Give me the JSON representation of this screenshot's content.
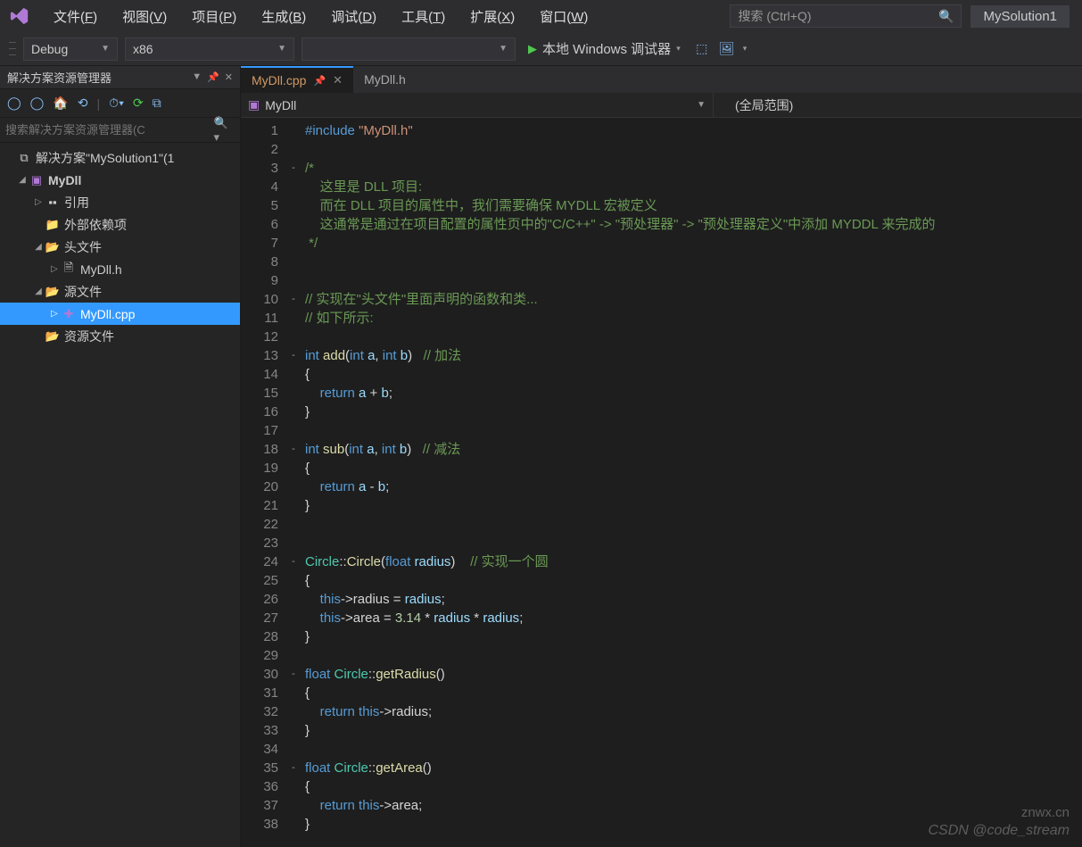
{
  "menubar": {
    "items": [
      "文件(F)",
      "视图(V)",
      "项目(P)",
      "生成(B)",
      "调试(D)",
      "工具(T)",
      "扩展(X)",
      "窗口(W)"
    ],
    "search_placeholder": "搜索 (Ctrl+Q)",
    "solution_label": "MySolution1"
  },
  "toolbar": {
    "config": "Debug",
    "platform": "x86",
    "target": "",
    "run_label": "本地 Windows 调试器"
  },
  "sidebar": {
    "title": "解决方案资源管理器",
    "search_placeholder": "搜索解决方案资源管理器(C",
    "solution": "解决方案\"MySolution1\"(1",
    "project": "MyDll",
    "refs": "引用",
    "external": "外部依赖项",
    "headers": "头文件",
    "header_file": "MyDll.h",
    "sources": "源文件",
    "source_file": "MyDll.cpp",
    "resources": "资源文件"
  },
  "tabs": {
    "active": "MyDll.cpp",
    "inactive": "MyDll.h"
  },
  "navbar": {
    "left": "MyDll",
    "right": "(全局范围)"
  },
  "code": {
    "lines": [
      {
        "n": 1,
        "f": "",
        "html": "<span class='kw'>#include</span> <span class='st'>\"MyDll.h\"</span>"
      },
      {
        "n": 2,
        "f": "",
        "html": ""
      },
      {
        "n": 3,
        "f": "-",
        "html": "<span class='cm'>/*</span>"
      },
      {
        "n": 4,
        "f": "",
        "html": "    <span class='cm'>这里是 DLL 项目:</span>"
      },
      {
        "n": 5,
        "f": "",
        "html": "    <span class='cm'>而在 DLL 项目的属性中，我们需要确保 MYDLL 宏被定义</span>"
      },
      {
        "n": 6,
        "f": "",
        "html": "    <span class='cm'>这通常是通过在项目配置的属性页中的\"C/C++\" -> \"预处理器\" -> \"预处理器定义\"中添加 MYDDL 来完成的</span>"
      },
      {
        "n": 7,
        "f": "",
        "html": " <span class='cm'>*/</span>"
      },
      {
        "n": 8,
        "f": "",
        "html": ""
      },
      {
        "n": 9,
        "f": "",
        "html": ""
      },
      {
        "n": 10,
        "f": "-",
        "html": "<span class='cm'>// 实现在\"头文件\"里面声明的函数和类...</span>"
      },
      {
        "n": 11,
        "f": "",
        "html": "<span class='cm'>// 如下所示:</span>"
      },
      {
        "n": 12,
        "f": "",
        "html": ""
      },
      {
        "n": 13,
        "f": "-",
        "html": "<span class='kw'>int</span> <span class='fn'>add</span>(<span class='kw'>int</span> <span class='id'>a</span>, <span class='kw'>int</span> <span class='id'>b</span>)   <span class='cm'>// 加法</span>"
      },
      {
        "n": 14,
        "f": "",
        "html": "{"
      },
      {
        "n": 15,
        "f": "",
        "html": "    <span class='kw'>return</span> <span class='id'>a</span> + <span class='id'>b</span>;"
      },
      {
        "n": 16,
        "f": "",
        "html": "}"
      },
      {
        "n": 17,
        "f": "",
        "html": ""
      },
      {
        "n": 18,
        "f": "-",
        "html": "<span class='kw'>int</span> <span class='fn'>sub</span>(<span class='kw'>int</span> <span class='id'>a</span>, <span class='kw'>int</span> <span class='id'>b</span>)   <span class='cm'>// 减法</span>"
      },
      {
        "n": 19,
        "f": "",
        "html": "{"
      },
      {
        "n": 20,
        "f": "",
        "html": "    <span class='kw'>return</span> <span class='id'>a</span> - <span class='id'>b</span>;"
      },
      {
        "n": 21,
        "f": "",
        "html": "}"
      },
      {
        "n": 22,
        "f": "",
        "html": ""
      },
      {
        "n": 23,
        "f": "",
        "html": ""
      },
      {
        "n": 24,
        "f": "-",
        "html": "<span class='ty'>Circle</span>::<span class='fn'>Circle</span>(<span class='kw'>float</span> <span class='id'>radius</span>)    <span class='cm'>// 实现一个圆</span>"
      },
      {
        "n": 25,
        "f": "",
        "html": "{"
      },
      {
        "n": 26,
        "f": "",
        "html": "    <span class='kw'>this</span>-&gt;radius = <span class='id'>radius</span>;"
      },
      {
        "n": 27,
        "f": "",
        "html": "    <span class='kw'>this</span>-&gt;area = <span class='nu'>3.14</span> * <span class='id'>radius</span> * <span class='id'>radius</span>;"
      },
      {
        "n": 28,
        "f": "",
        "html": "}"
      },
      {
        "n": 29,
        "f": "",
        "html": ""
      },
      {
        "n": 30,
        "f": "-",
        "html": "<span class='kw'>float</span> <span class='ty'>Circle</span>::<span class='fn'>getRadius</span>()"
      },
      {
        "n": 31,
        "f": "",
        "html": "{"
      },
      {
        "n": 32,
        "f": "",
        "html": "    <span class='kw'>return</span> <span class='kw'>this</span>-&gt;radius;"
      },
      {
        "n": 33,
        "f": "",
        "html": "}"
      },
      {
        "n": 34,
        "f": "",
        "html": ""
      },
      {
        "n": 35,
        "f": "-",
        "html": "<span class='kw'>float</span> <span class='ty'>Circle</span>::<span class='fn'>getArea</span>()"
      },
      {
        "n": 36,
        "f": "",
        "html": "{"
      },
      {
        "n": 37,
        "f": "",
        "html": "    <span class='kw'>return</span> <span class='kw'>this</span>-&gt;area;"
      },
      {
        "n": 38,
        "f": "",
        "html": "}"
      }
    ]
  },
  "watermark": {
    "l1": "znwx.cn",
    "l2": "CSDN @code_stream"
  }
}
